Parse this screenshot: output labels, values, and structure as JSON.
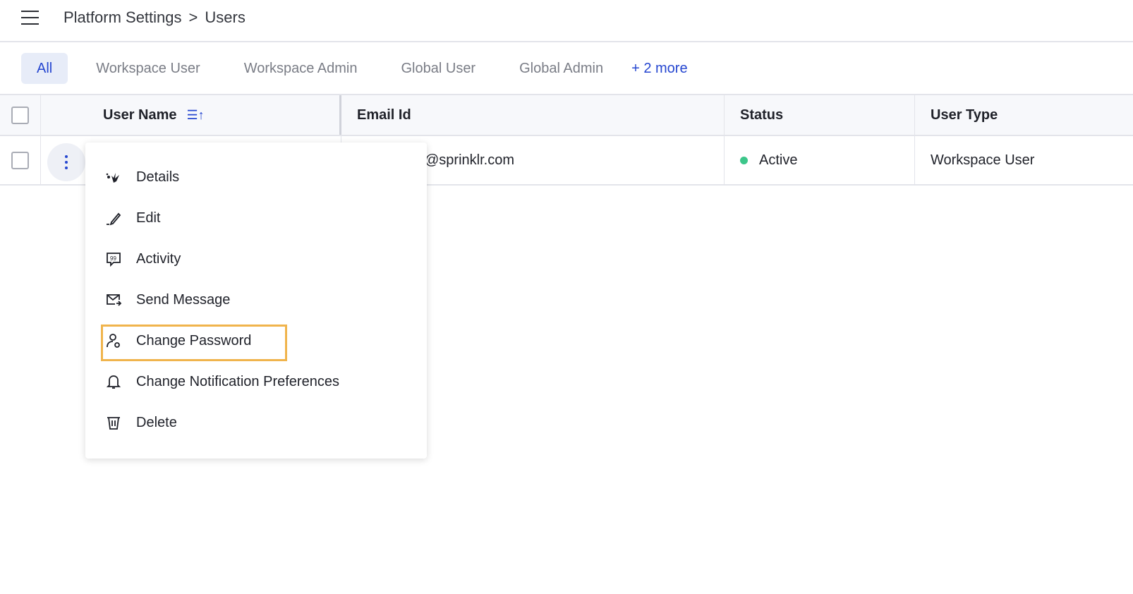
{
  "header": {
    "breadcrumb": [
      "Platform Settings",
      "Users"
    ],
    "separator": ">"
  },
  "tabs": [
    {
      "label": "All",
      "active": true
    },
    {
      "label": "Workspace User"
    },
    {
      "label": "Workspace Admin"
    },
    {
      "label": "Global User"
    },
    {
      "label": "Global Admin"
    }
  ],
  "more_tabs": "+ 2 more",
  "table": {
    "columns": [
      "User Name",
      "Email Id",
      "Status",
      "User Type"
    ],
    "rows": [
      {
        "email": "@sprinklr.com",
        "status": "Active",
        "user_type": "Workspace User"
      }
    ]
  },
  "colors": {
    "accent": "#2546d0",
    "active_status": "#3cc68a",
    "highlight": "#f0b44c"
  },
  "menu": {
    "items": [
      {
        "label": "Details",
        "icon": "details-icon"
      },
      {
        "label": "Edit",
        "icon": "pencil-icon"
      },
      {
        "label": "Activity",
        "icon": "quote-bubble-icon"
      },
      {
        "label": "Send Message",
        "icon": "mail-send-icon"
      },
      {
        "label": "Change Password",
        "icon": "user-key-icon",
        "highlighted": true
      },
      {
        "label": "Change Notification Preferences",
        "icon": "bell-icon"
      },
      {
        "label": "Delete",
        "icon": "trash-icon"
      }
    ]
  }
}
